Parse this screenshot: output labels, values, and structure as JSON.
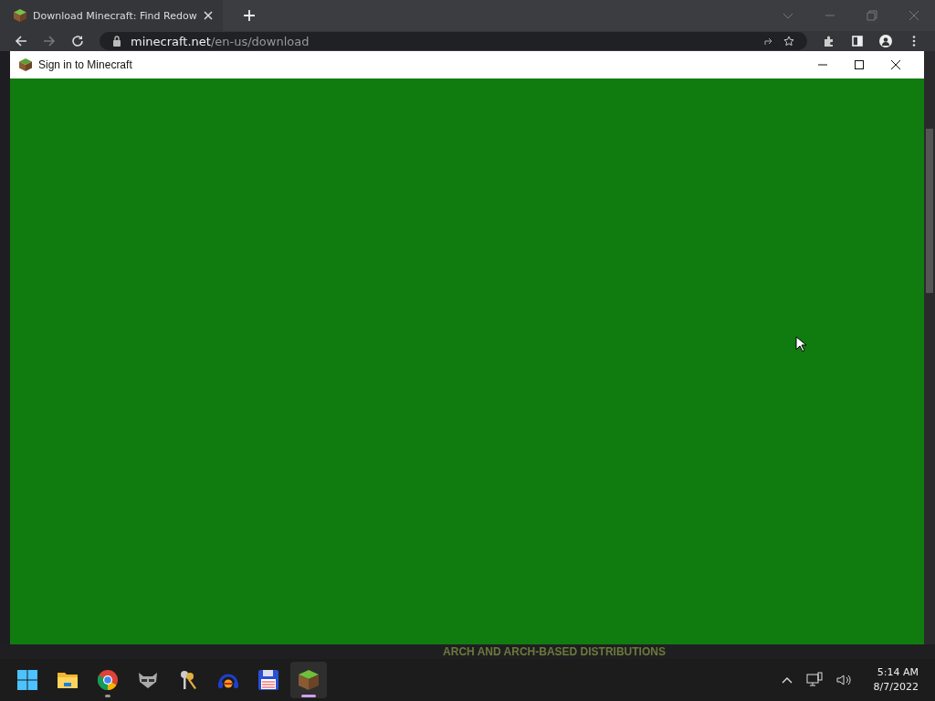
{
  "browser": {
    "tab": {
      "title": "Download Minecraft: Find Redow"
    },
    "address": {
      "host": "minecraft.net",
      "path": "/en-us/download"
    }
  },
  "dialog": {
    "title": "Sign in to Minecraft"
  },
  "page_heading": "ARCH AND ARCH-BASED DISTRIBUTIONS",
  "taskbar": {
    "apps": [
      {
        "kind": "start",
        "selected": false,
        "running": false
      },
      {
        "kind": "folder",
        "selected": false,
        "running": false
      },
      {
        "kind": "chrome",
        "selected": false,
        "running": true
      },
      {
        "kind": "raccoon",
        "selected": false,
        "running": false
      },
      {
        "kind": "keys",
        "selected": false,
        "running": false
      },
      {
        "kind": "headphones",
        "selected": false,
        "running": false
      },
      {
        "kind": "floppy",
        "selected": false,
        "running": false
      },
      {
        "kind": "block",
        "selected": true,
        "running": true
      }
    ],
    "clock": {
      "time": "5:14 AM",
      "date": "8/7/2022"
    }
  }
}
